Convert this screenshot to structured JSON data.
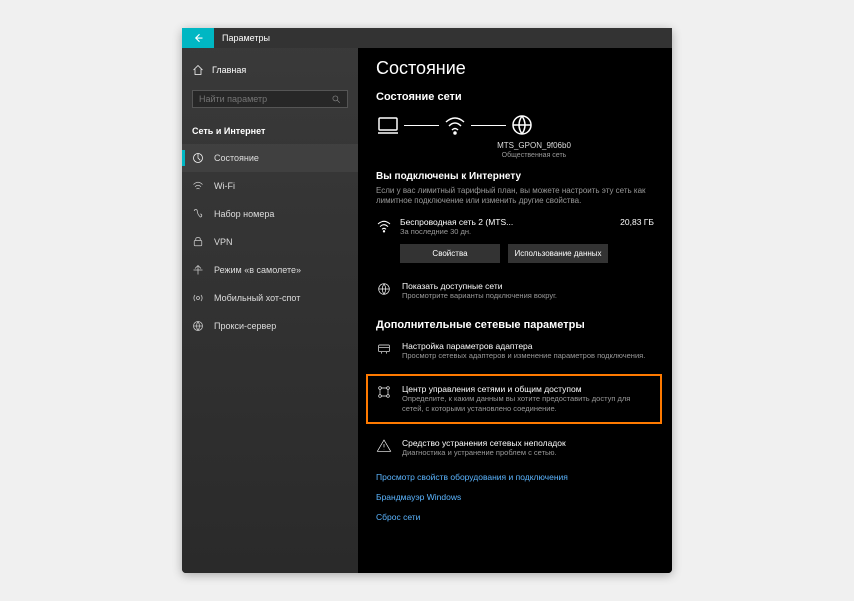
{
  "titlebar": {
    "label": "Параметры"
  },
  "sidebar": {
    "home": "Главная",
    "search_placeholder": "Найти параметр",
    "category": "Сеть и Интернет",
    "items": [
      {
        "label": "Состояние"
      },
      {
        "label": "Wi-Fi"
      },
      {
        "label": "Набор номера"
      },
      {
        "label": "VPN"
      },
      {
        "label": "Режим «в самолете»"
      },
      {
        "label": "Мобильный хот-спот"
      },
      {
        "label": "Прокси-сервер"
      }
    ]
  },
  "main": {
    "title": "Состояние",
    "net_status_h": "Состояние сети",
    "net_name": "MTS_GPON_9f06b0",
    "net_type": "Общественная сеть",
    "connected_h": "Вы подключены к Интернету",
    "connected_desc": "Если у вас лимитный тарифный план, вы можете настроить эту сеть как лимитное подключение или изменить другие свойства.",
    "conn": {
      "name": "Беспроводная сеть 2 (MTS...",
      "sub": "За последние 30 дн.",
      "data": "20,83 ГБ"
    },
    "btn_props": "Свойства",
    "btn_usage": "Использование данных",
    "show_nets": {
      "title": "Показать доступные сети",
      "desc": "Просмотрите варианты подключения вокруг."
    },
    "adv_h": "Дополнительные сетевые параметры",
    "adapter": {
      "title": "Настройка параметров адаптера",
      "desc": "Просмотр сетевых адаптеров и изменение параметров подключения."
    },
    "sharing": {
      "title": "Центр управления сетями и общим доступом",
      "desc": "Определите, к каким данным вы хотите предоставить доступ для сетей, с которыми установлено соединение."
    },
    "troubleshoot": {
      "title": "Средство устранения сетевых неполадок",
      "desc": "Диагностика и устранение проблем с сетью."
    },
    "link_hw": "Просмотр свойств оборудования и подключения",
    "link_fw": "Брандмауэр Windows",
    "link_reset": "Сброс сети"
  }
}
